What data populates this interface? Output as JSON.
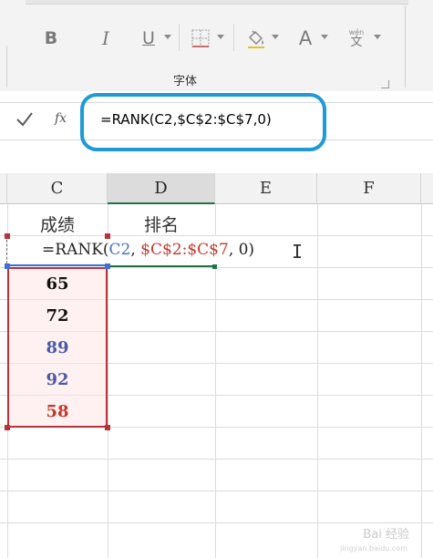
{
  "ribbon": {
    "bold": "B",
    "italic": "I",
    "underline": "U",
    "font_color": "A",
    "wen_top": "wén",
    "wen_bottom": "文",
    "group_label": "字体"
  },
  "formula_bar": {
    "fx": "fx",
    "text": "=RANK(C2,$C$2:$C$7,0)"
  },
  "columns": [
    "C",
    "D",
    "E",
    "F"
  ],
  "selected_column": "D",
  "sheet": {
    "header_c": "成绩",
    "header_d": "排名",
    "editing_formula": {
      "prefix": "=RANK(",
      "arg1": "C2",
      "comma1": ", ",
      "arg2": "$C$2:$C$7",
      "rest": ", 0)"
    },
    "scores": [
      {
        "value": "65",
        "color": "#111111"
      },
      {
        "value": "72",
        "color": "#111111"
      },
      {
        "value": "89",
        "color": "#4a5aa8"
      },
      {
        "value": "92",
        "color": "#4a5aa8"
      },
      {
        "value": "58",
        "color": "#c0392b"
      }
    ]
  },
  "watermark": {
    "main": "Bai 经验",
    "sub": "jingyan.baidu.com"
  },
  "colors": {
    "accent": "#1e9ad6",
    "select_green": "#217346",
    "range_red": "#b8323a",
    "ref_blue": "#3f6fd6"
  }
}
